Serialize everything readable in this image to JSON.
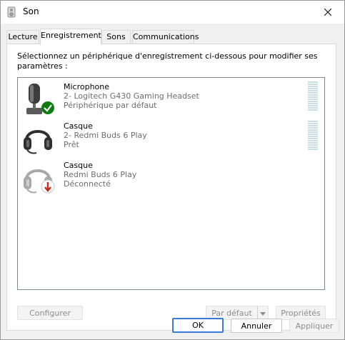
{
  "window": {
    "title": "Son"
  },
  "tabs": [
    {
      "label": "Lecture"
    },
    {
      "label": "Enregistrement"
    },
    {
      "label": "Sons"
    },
    {
      "label": "Communications"
    }
  ],
  "panel": {
    "instruction": "Sélectionnez un périphérique d'enregistrement ci-dessous pour modifier ses paramètres :"
  },
  "devices": [
    {
      "name": "Microphone",
      "description": "2- Logitech G430 Gaming Headset",
      "status": "Périphérique par défaut",
      "icon": "microphone-icon",
      "badge": "default-check-icon"
    },
    {
      "name": "Casque",
      "description": "2- Redmi Buds 6 Play",
      "status": "Prêt",
      "icon": "headset-icon",
      "badge": ""
    },
    {
      "name": "Casque",
      "description": "Redmi Buds 6 Play",
      "status": "Déconnecté",
      "icon": "headset-icon",
      "badge": "disconnected-arrow-icon"
    }
  ],
  "buttons": {
    "configure": "Configurer",
    "set_default": "Par défaut",
    "properties": "Propriétés",
    "ok": "OK",
    "cancel": "Annuler",
    "apply": "Appliquer"
  },
  "colors": {
    "accent": "#3a7bd5",
    "check_badge": "#0f7b0f",
    "disconnected_badge": "#c42b1c",
    "meter": "#c8dfe6"
  }
}
